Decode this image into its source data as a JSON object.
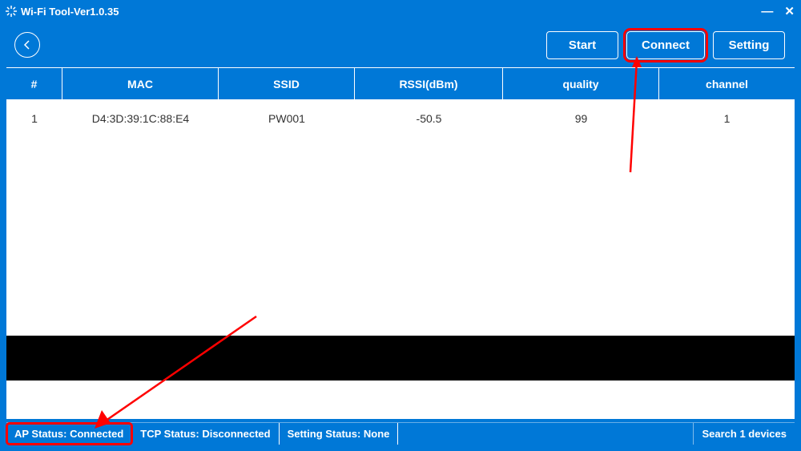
{
  "window": {
    "title": "Wi-Fi Tool-Ver1.0.35"
  },
  "toolbar": {
    "start_label": "Start",
    "connect_label": "Connect",
    "setting_label": "Setting"
  },
  "table": {
    "headers": {
      "num": "#",
      "mac": "MAC",
      "ssid": "SSID",
      "rssi": "RSSI(dBm)",
      "quality": "quality",
      "channel": "channel"
    },
    "rows": [
      {
        "num": "1",
        "mac": "D4:3D:39:1C:88:E4",
        "ssid": "PW001",
        "rssi": "-50.5",
        "quality": "99",
        "channel": "1"
      }
    ]
  },
  "status": {
    "ap": "AP Status: Connected",
    "tcp": "TCP Status: Disconnected",
    "setting": "Setting Status: None",
    "devices": "Search 1 devices"
  }
}
